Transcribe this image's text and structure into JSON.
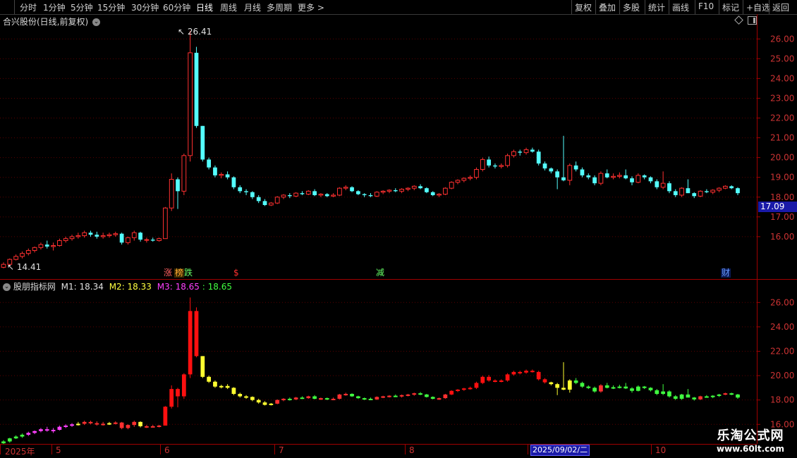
{
  "toolbar": {
    "periods": [
      "分时",
      "1分钟",
      "5分钟",
      "15分钟",
      "30分钟",
      "60分钟",
      "日线",
      "周线",
      "月线",
      "多周期",
      "更多 >"
    ],
    "active_period": "日线",
    "actions": [
      "复权",
      "叠加",
      "多股",
      "统计",
      "画线",
      "F10",
      "标记",
      "+自选",
      "返回"
    ]
  },
  "main_chart": {
    "title": "合兴股份(日线,前复权)",
    "high_label": "26.41",
    "low_label": "14.41",
    "current_price": "17.09",
    "y_ticks": [
      "26.00",
      "25.00",
      "24.00",
      "23.00",
      "22.00",
      "21.00",
      "20.00",
      "19.00",
      "18.00",
      "17.00",
      "16.00"
    ],
    "markers": [
      {
        "text": "涨",
        "color": "#ff6060"
      },
      {
        "text": "榜",
        "color": "#ffaa33"
      },
      {
        "text": "跌",
        "color": "#66ff66"
      },
      {
        "text": "$",
        "color": "#ff3030"
      },
      {
        "text": "减",
        "color": "#66ff66"
      },
      {
        "text": "财",
        "color": "#6699ff"
      }
    ]
  },
  "sub_chart": {
    "title": "股朋指标网",
    "m1": "M1: 18.34",
    "m2": "M2: 18.33",
    "m3": "M3: 18.65",
    "m4": ": 18.65",
    "y_ticks": [
      "26.00",
      "24.00",
      "22.00",
      "20.00",
      "18.00",
      "16.00"
    ]
  },
  "time_axis": {
    "labels": [
      "2025年",
      "5",
      "6",
      "7",
      "8",
      "9",
      "10"
    ],
    "cursor_date": "2025/09/02/二"
  },
  "brand": {
    "name": "乐淘公式网",
    "url": "www.60lt.com"
  },
  "colors": {
    "up": "#ff3030",
    "down": "#54ffff",
    "axis": "#a00000",
    "current_price_bg": "#1a1aa8"
  },
  "chart_data": {
    "type": "candlestick",
    "ylim_main": [
      14.0,
      26.9
    ],
    "ylim_sub": [
      15.9,
      27.0
    ],
    "candles": [
      [
        14.45,
        14.7,
        14.4,
        14.6
      ],
      [
        14.6,
        14.9,
        14.5,
        14.85
      ],
      [
        14.85,
        15.1,
        14.8,
        15.0
      ],
      [
        15.0,
        15.25,
        14.9,
        15.15
      ],
      [
        15.15,
        15.4,
        15.05,
        15.3
      ],
      [
        15.3,
        15.5,
        15.2,
        15.45
      ],
      [
        15.45,
        15.7,
        15.35,
        15.6
      ],
      [
        15.6,
        15.8,
        15.4,
        15.5
      ],
      [
        15.5,
        15.7,
        15.3,
        15.55
      ],
      [
        15.55,
        15.9,
        15.5,
        15.8
      ],
      [
        15.8,
        16.0,
        15.7,
        15.9
      ],
      [
        15.9,
        16.1,
        15.8,
        16.0
      ],
      [
        16.0,
        16.2,
        15.9,
        16.05
      ],
      [
        16.05,
        16.3,
        15.95,
        16.2
      ],
      [
        16.2,
        16.3,
        16.0,
        16.1
      ],
      [
        16.1,
        16.25,
        15.9,
        16.0
      ],
      [
        16.0,
        16.2,
        15.9,
        16.05
      ],
      [
        16.05,
        16.2,
        15.95,
        16.1
      ],
      [
        16.1,
        16.25,
        16.0,
        16.15
      ],
      [
        16.15,
        16.2,
        15.6,
        15.7
      ],
      [
        15.7,
        16.0,
        15.6,
        15.95
      ],
      [
        15.95,
        16.3,
        15.8,
        16.2
      ],
      [
        16.2,
        16.25,
        15.75,
        15.85
      ],
      [
        15.85,
        15.95,
        15.7,
        15.85
      ],
      [
        15.85,
        15.95,
        15.75,
        15.8
      ],
      [
        15.8,
        15.95,
        15.75,
        15.9
      ],
      [
        15.9,
        17.5,
        15.9,
        17.45
      ],
      [
        17.45,
        19.2,
        17.3,
        18.9
      ],
      [
        18.9,
        19.0,
        17.4,
        18.3
      ],
      [
        18.3,
        20.2,
        18.1,
        20.1
      ],
      [
        20.1,
        26.41,
        19.8,
        25.3
      ],
      [
        25.3,
        25.6,
        21.5,
        21.6
      ],
      [
        21.6,
        21.6,
        19.8,
        19.9
      ],
      [
        19.9,
        20.0,
        19.4,
        19.5
      ],
      [
        19.5,
        19.6,
        19.0,
        19.1
      ],
      [
        19.1,
        19.25,
        18.95,
        19.15
      ],
      [
        19.15,
        19.3,
        18.9,
        19.0
      ],
      [
        19.0,
        19.05,
        18.4,
        18.5
      ],
      [
        18.5,
        18.6,
        18.2,
        18.3
      ],
      [
        18.3,
        18.4,
        18.1,
        18.25
      ],
      [
        18.25,
        18.3,
        17.9,
        18.0
      ],
      [
        18.0,
        18.1,
        17.7,
        17.8
      ],
      [
        17.8,
        17.9,
        17.55,
        17.6
      ],
      [
        17.6,
        17.75,
        17.55,
        17.7
      ],
      [
        17.7,
        18.05,
        17.65,
        18.0
      ],
      [
        18.0,
        18.15,
        17.9,
        18.1
      ],
      [
        18.1,
        18.2,
        17.95,
        18.05
      ],
      [
        18.05,
        18.25,
        18.0,
        18.2
      ],
      [
        18.2,
        18.3,
        18.1,
        18.15
      ],
      [
        18.15,
        18.35,
        18.1,
        18.3
      ],
      [
        18.3,
        18.4,
        18.05,
        18.1
      ],
      [
        18.1,
        18.2,
        18.0,
        18.15
      ],
      [
        18.15,
        18.2,
        18.0,
        18.05
      ],
      [
        18.05,
        18.2,
        18.0,
        18.1
      ],
      [
        18.1,
        18.5,
        18.05,
        18.45
      ],
      [
        18.45,
        18.6,
        18.35,
        18.5
      ],
      [
        18.5,
        18.55,
        18.25,
        18.3
      ],
      [
        18.3,
        18.35,
        18.1,
        18.15
      ],
      [
        18.15,
        18.2,
        18.0,
        18.1
      ],
      [
        18.1,
        18.2,
        18.0,
        18.05
      ],
      [
        18.05,
        18.3,
        18.0,
        18.25
      ],
      [
        18.25,
        18.35,
        18.15,
        18.3
      ],
      [
        18.3,
        18.4,
        18.2,
        18.35
      ],
      [
        18.35,
        18.45,
        18.25,
        18.3
      ],
      [
        18.3,
        18.45,
        18.2,
        18.4
      ],
      [
        18.4,
        18.5,
        18.3,
        18.45
      ],
      [
        18.45,
        18.6,
        18.35,
        18.55
      ],
      [
        18.55,
        18.65,
        18.4,
        18.45
      ],
      [
        18.45,
        18.5,
        18.2,
        18.25
      ],
      [
        18.25,
        18.3,
        18.05,
        18.1
      ],
      [
        18.1,
        18.2,
        18.0,
        18.15
      ],
      [
        18.15,
        18.5,
        18.1,
        18.45
      ],
      [
        18.45,
        18.8,
        18.4,
        18.75
      ],
      [
        18.75,
        18.9,
        18.65,
        18.85
      ],
      [
        18.85,
        19.0,
        18.75,
        18.95
      ],
      [
        18.95,
        19.1,
        18.85,
        19.0
      ],
      [
        19.0,
        19.5,
        18.9,
        19.4
      ],
      [
        19.4,
        20.0,
        19.3,
        19.9
      ],
      [
        19.9,
        20.05,
        19.5,
        19.6
      ],
      [
        19.6,
        19.7,
        19.45,
        19.55
      ],
      [
        19.55,
        19.7,
        19.45,
        19.6
      ],
      [
        19.6,
        20.2,
        19.5,
        20.1
      ],
      [
        20.1,
        20.4,
        20.0,
        20.3
      ],
      [
        20.3,
        20.4,
        20.1,
        20.25
      ],
      [
        20.25,
        20.5,
        20.15,
        20.4
      ],
      [
        20.4,
        20.5,
        20.25,
        20.3
      ],
      [
        20.3,
        20.4,
        19.6,
        19.7
      ],
      [
        19.7,
        19.8,
        19.35,
        19.45
      ],
      [
        19.45,
        19.5,
        19.2,
        19.3
      ],
      [
        19.3,
        19.4,
        18.4,
        19.0
      ],
      [
        19.0,
        21.1,
        18.8,
        18.85
      ],
      [
        18.85,
        19.7,
        18.6,
        19.6
      ],
      [
        19.6,
        19.8,
        19.3,
        19.4
      ],
      [
        19.4,
        19.5,
        19.0,
        19.1
      ],
      [
        19.1,
        19.2,
        18.9,
        19.0
      ],
      [
        19.0,
        19.1,
        18.6,
        18.7
      ],
      [
        18.7,
        19.3,
        18.6,
        19.2
      ],
      [
        19.2,
        19.4,
        18.95,
        19.0
      ],
      [
        19.0,
        19.2,
        18.9,
        19.05
      ],
      [
        19.05,
        19.25,
        18.95,
        19.1
      ],
      [
        19.1,
        19.4,
        18.9,
        18.95
      ],
      [
        18.95,
        19.05,
        18.6,
        18.75
      ],
      [
        18.75,
        19.2,
        18.7,
        19.1
      ],
      [
        19.1,
        19.15,
        18.9,
        19.0
      ],
      [
        19.0,
        19.05,
        18.7,
        18.8
      ],
      [
        18.8,
        18.9,
        18.4,
        18.5
      ],
      [
        18.5,
        19.3,
        18.4,
        18.7
      ],
      [
        18.7,
        18.8,
        18.2,
        18.3
      ],
      [
        18.3,
        18.4,
        18.0,
        18.1
      ],
      [
        18.1,
        18.5,
        18.0,
        18.45
      ],
      [
        18.45,
        18.9,
        18.3,
        18.2
      ],
      [
        18.2,
        18.25,
        17.95,
        18.05
      ],
      [
        18.05,
        18.35,
        18.0,
        18.3
      ],
      [
        18.3,
        18.4,
        18.2,
        18.25
      ],
      [
        18.25,
        18.4,
        18.15,
        18.35
      ],
      [
        18.35,
        18.5,
        18.25,
        18.45
      ],
      [
        18.45,
        18.6,
        18.4,
        18.55
      ],
      [
        18.55,
        18.6,
        18.4,
        18.45
      ],
      [
        18.45,
        18.5,
        18.1,
        18.2
      ]
    ]
  }
}
